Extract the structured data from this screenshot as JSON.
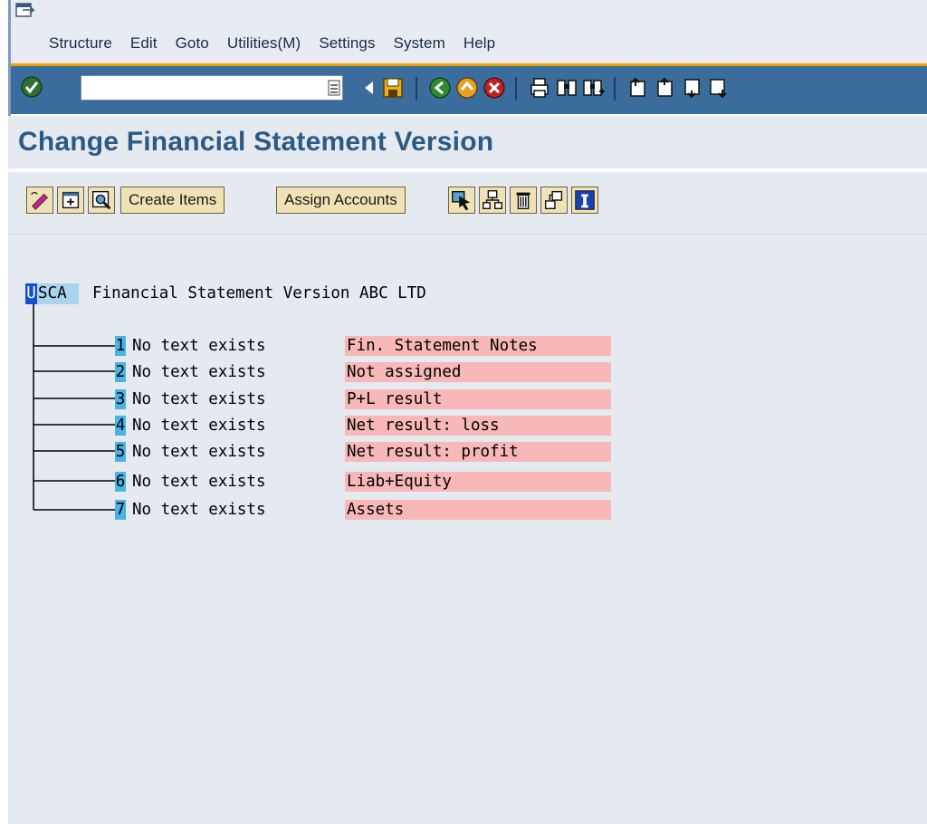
{
  "menu": {
    "items": [
      "Structure",
      "Edit",
      "Goto",
      "Utilities(M)",
      "Settings",
      "System",
      "Help"
    ]
  },
  "toolbar": {
    "command_field_value": "",
    "icons": [
      "ok-check-icon",
      "command-dropdown-icon",
      "back-triangle-icon",
      "save-icon",
      "back-icon",
      "exit-icon",
      "cancel-icon",
      "print-icon",
      "find-icon",
      "find-next-icon",
      "first-page-icon",
      "previous-page-icon",
      "next-page-icon",
      "last-page-icon"
    ]
  },
  "page": {
    "title": "Change Financial Statement Version"
  },
  "app_toolbar": {
    "create_items_label": "Create Items",
    "assign_accounts_label": "Assign Accounts",
    "icons": [
      "edit-icon",
      "expand-subtree-icon",
      "zoom-icon",
      "select-icon",
      "reassign-icon",
      "delete-icon",
      "move-icon",
      "info-icon"
    ]
  },
  "tree": {
    "root": {
      "key_first": "U",
      "key_rest": "SCA",
      "description": "Financial Statement Version ABC LTD"
    },
    "nodes": [
      {
        "number": "1",
        "text": "No text exists",
        "description": "Fin. Statement Notes"
      },
      {
        "number": "2",
        "text": "No text exists",
        "description": "Not assigned"
      },
      {
        "number": "3",
        "text": "No text exists",
        "description": "P+L result"
      },
      {
        "number": "4",
        "text": "No text exists",
        "description": "Net result: loss"
      },
      {
        "number": "5",
        "text": "No text exists",
        "description": "Net result: profit"
      },
      {
        "number": "6",
        "text": "No text exists",
        "description": "Liab+Equity"
      },
      {
        "number": "7",
        "text": "No text exists",
        "description": "Assets"
      }
    ]
  },
  "colors": {
    "title": "#2b5a86",
    "toolbar_bg": "#3a6d9b",
    "menu_rule": "#f0a400",
    "button_bg": "#efe2b5",
    "node_number_bg": "#4ab3e6",
    "node_desc_bg": "#f8b8b8",
    "root_key_bg": "#a8d4ee",
    "background": "#e5e9f0"
  }
}
